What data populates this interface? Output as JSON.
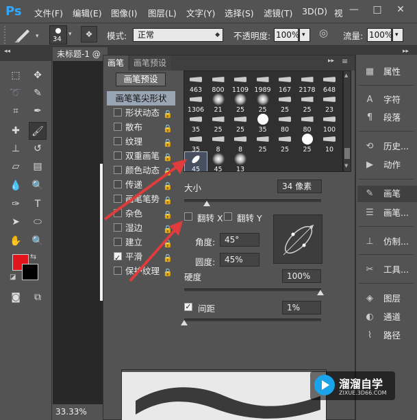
{
  "app": {
    "logo": "Ps"
  },
  "menu": [
    "文件(F)",
    "编辑(E)",
    "图像(I)",
    "图层(L)",
    "文字(Y)",
    "选择(S)",
    "滤镜(T)",
    "3D(D)",
    "视"
  ],
  "window_controls": {
    "minimize": "—",
    "maximize": "□",
    "close": "✕"
  },
  "options": {
    "brush_size": "34",
    "mode_label": "模式:",
    "mode_value": "正常",
    "opacity_label": "不透明度:",
    "opacity_value": "100%",
    "flow_label": "流量:",
    "flow_value": "100%"
  },
  "document": {
    "tab_title": "未标题-1 @",
    "zoom": "33.33%"
  },
  "brush_panel": {
    "tabs": [
      "画笔",
      "画笔预设"
    ],
    "preset_button": "画笔预设",
    "options": [
      {
        "label": "画笔笔尖形状",
        "selected": true
      },
      {
        "label": "形状动态",
        "checked": false,
        "lock": true
      },
      {
        "label": "散布",
        "checked": false,
        "lock": true
      },
      {
        "label": "纹理",
        "checked": false,
        "lock": true
      },
      {
        "label": "双重画笔",
        "checked": false,
        "lock": true
      },
      {
        "label": "颜色动态",
        "checked": false,
        "lock": true
      },
      {
        "label": "传递",
        "checked": false,
        "lock": true
      },
      {
        "label": "画笔笔势",
        "checked": false,
        "lock": true
      },
      {
        "label": "杂色",
        "checked": false,
        "lock": true
      },
      {
        "label": "湿边",
        "checked": false,
        "lock": true
      },
      {
        "label": "建立",
        "checked": false,
        "lock": true
      },
      {
        "label": "平滑",
        "checked": true,
        "lock": true
      },
      {
        "label": "保护纹理",
        "checked": false,
        "lock": true
      }
    ],
    "tip_rows": [
      [
        "463",
        "800",
        "1109",
        "1989",
        "167",
        "2178",
        "648"
      ],
      [
        "1306",
        "21",
        "25",
        "25",
        "25",
        "25",
        "23"
      ],
      [
        "35",
        "25",
        "25",
        "35",
        "80",
        "80",
        "100"
      ],
      [
        "35",
        "8",
        "8",
        "25",
        "25",
        "25",
        "10"
      ],
      [
        "45",
        "45",
        "13"
      ]
    ],
    "size_label": "大小",
    "size_value": "34 像素",
    "flip_x_label": "翻转 X",
    "flip_y_label": "翻转 Y",
    "angle_label": "角度:",
    "angle_value": "45°",
    "roundness_label": "圆度:",
    "roundness_value": "45%",
    "hardness_label": "硬度",
    "hardness_value": "100%",
    "spacing_label": "间距",
    "spacing_value": "1%"
  },
  "dock": [
    {
      "icon": "properties-icon",
      "label": "属性"
    },
    {
      "icon": "character-icon",
      "label": "字符"
    },
    {
      "icon": "paragraph-icon",
      "label": "段落"
    },
    {
      "icon": "history-icon",
      "label": "历史..."
    },
    {
      "icon": "actions-icon",
      "label": "动作"
    },
    {
      "icon": "brush-icon",
      "label": "画笔",
      "active": true
    },
    {
      "icon": "brush-presets-icon",
      "label": "画笔..."
    },
    {
      "icon": "clone-source-icon",
      "label": "仿制..."
    },
    {
      "icon": "tool-presets-icon",
      "label": "工具..."
    },
    {
      "icon": "layers-icon",
      "label": "图层"
    },
    {
      "icon": "channels-icon",
      "label": "通道"
    },
    {
      "icon": "paths-icon",
      "label": "路径"
    }
  ],
  "watermark": {
    "title": "溜溜自学",
    "url": "ZIXUE.3D66.COM"
  },
  "colors": {
    "foreground": "#e0141a",
    "background": "#000000",
    "accent": "#31a8ff",
    "annotation_arrow": "#e03c3c"
  }
}
